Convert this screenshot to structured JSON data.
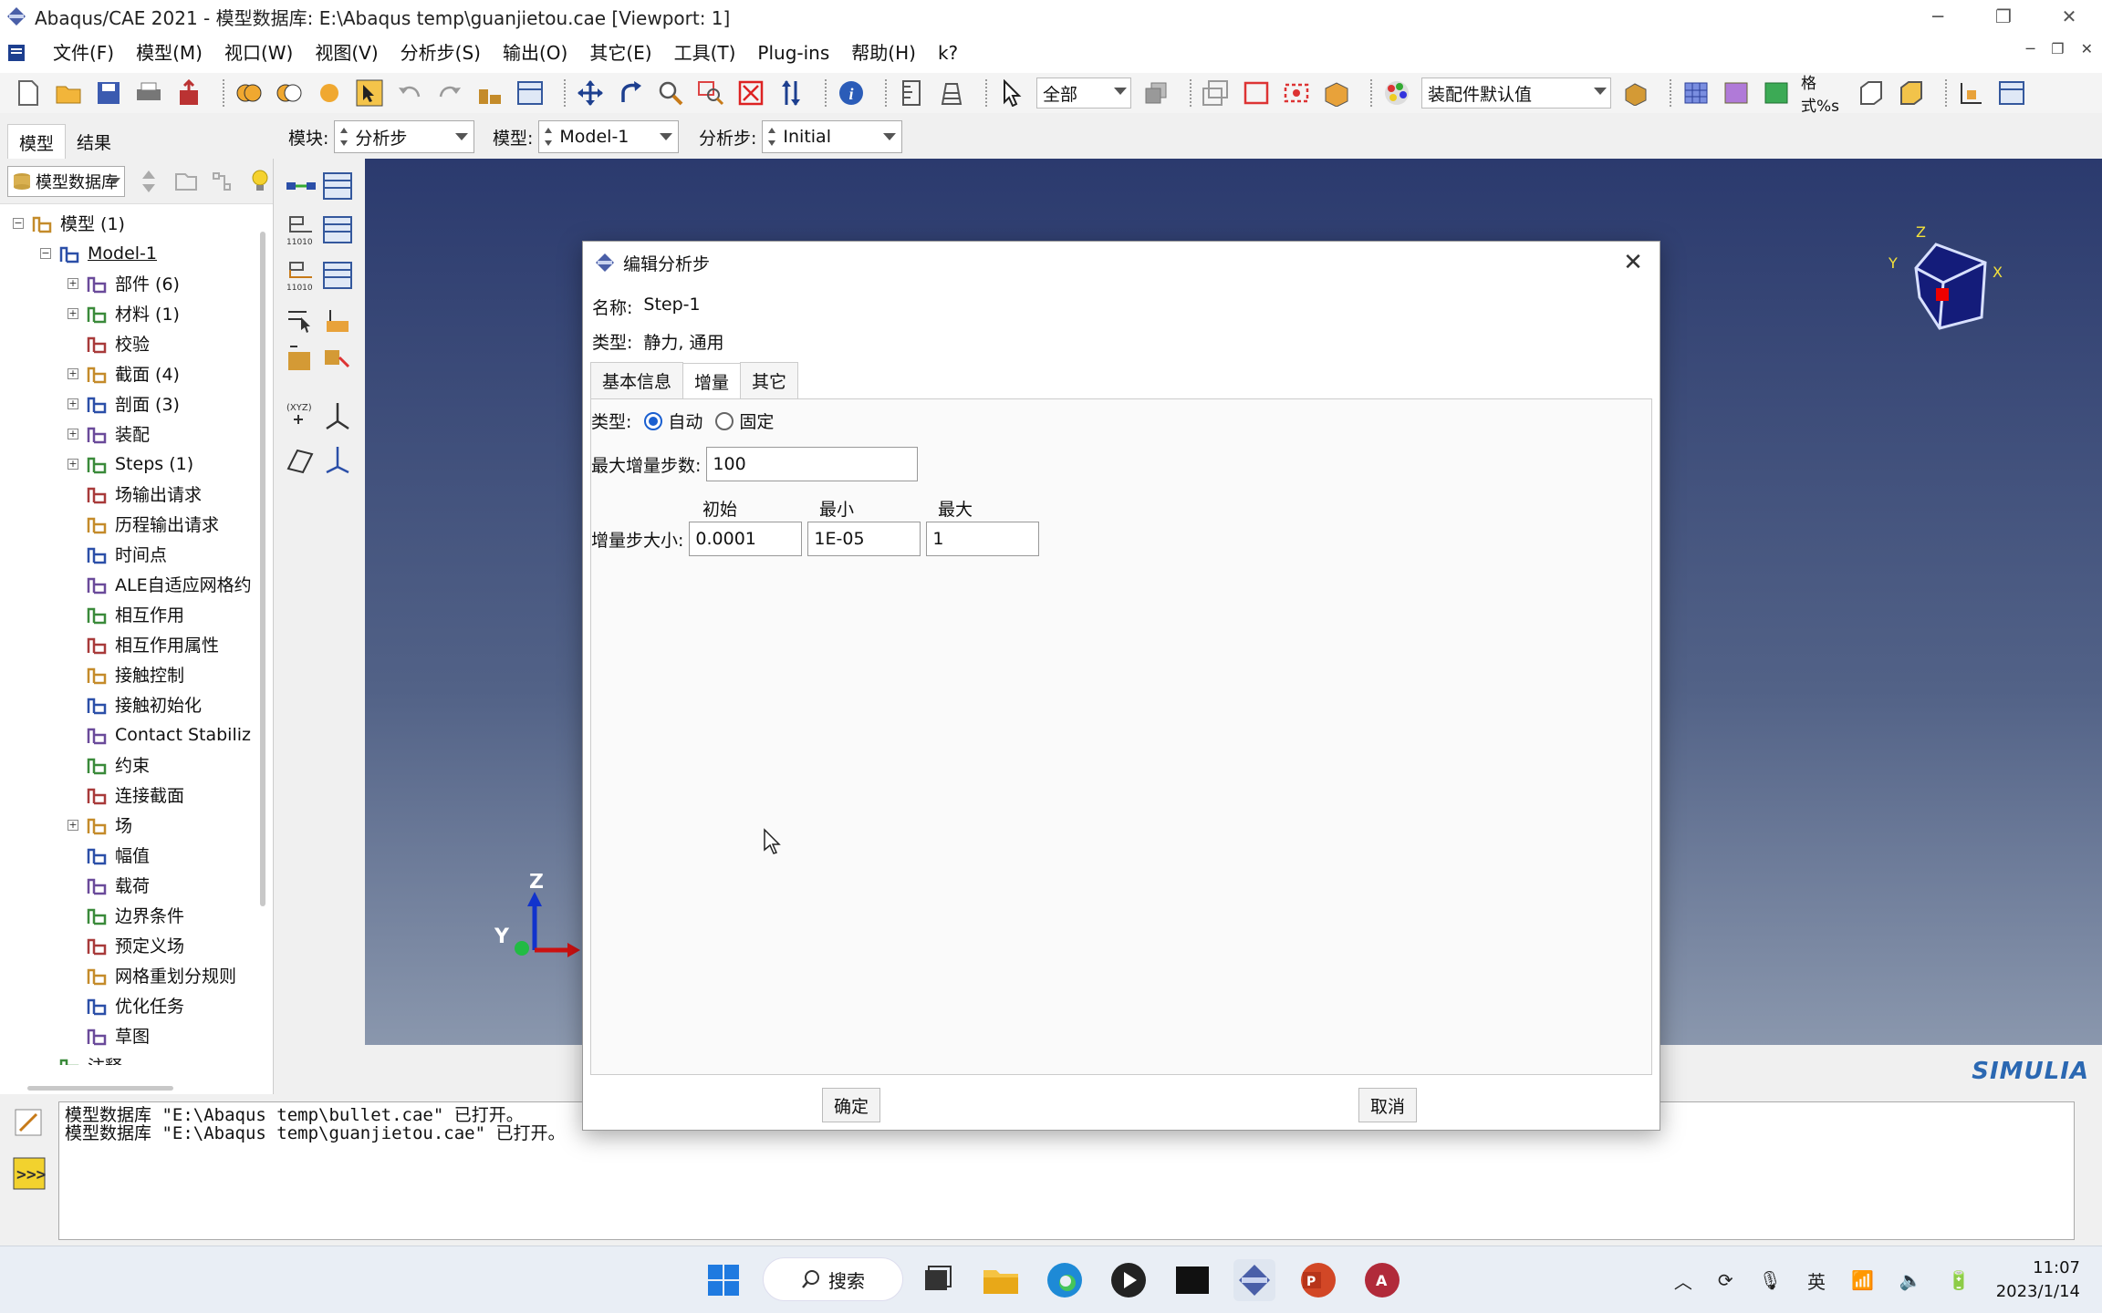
{
  "window": {
    "title": "Abaqus/CAE 2021 - 模型数据库: E:\\Abaqus temp\\guanjietou.cae [Viewport: 1]",
    "minimize": "─",
    "restore": "❐",
    "close": "✕"
  },
  "menu": {
    "items": [
      "文件(F)",
      "模型(M)",
      "视口(W)",
      "视图(V)",
      "分析步(S)",
      "输出(O)",
      "其它(E)",
      "工具(T)",
      "Plug-ins",
      "帮助(H)",
      "k?"
    ]
  },
  "toolbar": {
    "selection_filter": "全部",
    "assembly_defaults": "装配件默认值",
    "render_label": "格式%s"
  },
  "context": {
    "tabs": [
      "模型",
      "结果"
    ],
    "module_label": "模块:",
    "module_value": "分析步",
    "model_label": "模型:",
    "model_value": "Model-1",
    "step_label": "分析步:",
    "step_value": "Initial"
  },
  "tree": {
    "filter": "模型数据库",
    "rows": [
      {
        "label": "模型 (1)",
        "level": 0,
        "expander": "⊟"
      },
      {
        "label": "Model-1",
        "level": 1,
        "expander": "⊟",
        "underline": true
      },
      {
        "label": "部件 (6)",
        "level": 2,
        "expander": "⊞"
      },
      {
        "label": "材料 (1)",
        "level": 2,
        "expander": "⊞"
      },
      {
        "label": "校验",
        "level": 2,
        "expander": ""
      },
      {
        "label": "截面 (4)",
        "level": 2,
        "expander": "⊞"
      },
      {
        "label": "剖面 (3)",
        "level": 2,
        "expander": "⊞"
      },
      {
        "label": "装配",
        "level": 2,
        "expander": "⊞"
      },
      {
        "label": "Steps (1)",
        "level": 2,
        "expander": "⊞"
      },
      {
        "label": "场输出请求",
        "level": 2,
        "expander": ""
      },
      {
        "label": "历程输出请求",
        "level": 2,
        "expander": ""
      },
      {
        "label": "时间点",
        "level": 2,
        "expander": ""
      },
      {
        "label": "ALE自适应网格约",
        "level": 2,
        "expander": ""
      },
      {
        "label": "相互作用",
        "level": 2,
        "expander": ""
      },
      {
        "label": "相互作用属性",
        "level": 2,
        "expander": ""
      },
      {
        "label": "接触控制",
        "level": 2,
        "expander": ""
      },
      {
        "label": "接触初始化",
        "level": 2,
        "expander": ""
      },
      {
        "label": "Contact Stabiliz",
        "level": 2,
        "expander": ""
      },
      {
        "label": "约束",
        "level": 2,
        "expander": ""
      },
      {
        "label": "连接截面",
        "level": 2,
        "expander": ""
      },
      {
        "label": "场",
        "level": 2,
        "expander": "⊞"
      },
      {
        "label": "幅值",
        "level": 2,
        "expander": ""
      },
      {
        "label": "载荷",
        "level": 2,
        "expander": ""
      },
      {
        "label": "边界条件",
        "level": 2,
        "expander": ""
      },
      {
        "label": "预定义场",
        "level": 2,
        "expander": ""
      },
      {
        "label": "网格重划分规则",
        "level": 2,
        "expander": ""
      },
      {
        "label": "优化任务",
        "level": 2,
        "expander": ""
      },
      {
        "label": "草图",
        "level": 2,
        "expander": ""
      },
      {
        "label": "注释",
        "level": 1,
        "expander": ""
      }
    ]
  },
  "viewport": {
    "axis_x": "X",
    "axis_y": "Y",
    "axis_z": "Z",
    "brand": "SIMULIA"
  },
  "messages": {
    "lines": [
      "模型数据库 \"E:\\Abaqus temp\\bullet.cae\" 已打开。",
      "模型数据库 \"E:\\Abaqus temp\\guanjietou.cae\" 已打开。"
    ]
  },
  "dialog": {
    "title": "编辑分析步",
    "name_label": "名称:",
    "name_value": "Step-1",
    "type_label": "类型:",
    "type_value": "静力, 通用",
    "tabs": [
      "基本信息",
      "增量",
      "其它"
    ],
    "active_tab": "增量",
    "incr_type_label": "类型:",
    "incr_type_auto": "自动",
    "incr_type_fixed": "固定",
    "max_incr_label": "最大增量步数:",
    "max_incr_value": "100",
    "col_initial": "初始",
    "col_min": "最小",
    "col_max": "最大",
    "incr_size_label": "增量步大小:",
    "initial_value": "0.0001",
    "min_value": "1E-05",
    "max_value": "1",
    "ok": "确定",
    "cancel": "取消"
  },
  "taskbar": {
    "search": "搜索",
    "ime": "英",
    "time": "11:07",
    "date": "2023/1/14"
  },
  "colors": {
    "viewport_top": "#2b3a6e",
    "viewport_bottom": "#8a97ad",
    "accent": "#1a5fd0",
    "brand": "#2b68b2"
  }
}
